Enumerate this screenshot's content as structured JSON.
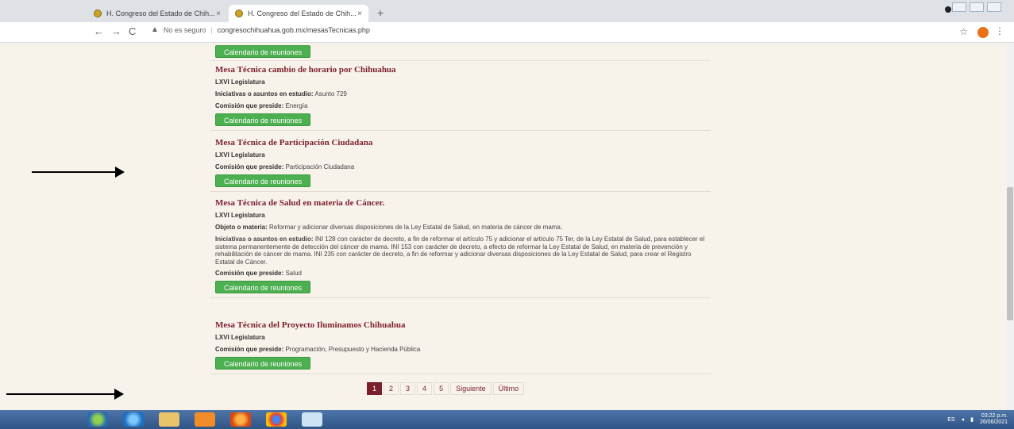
{
  "browser": {
    "tabs": [
      {
        "label": "H. Congreso del Estado de Chih...",
        "close": "×"
      },
      {
        "label": "H. Congreso del Estado de Chih...",
        "close": "×"
      }
    ],
    "new_tab": "+",
    "nav": {
      "back": "←",
      "forward": "→",
      "reload": "C"
    },
    "security_label": "No es seguro",
    "url": "congresochihuahua.gob.mx/mesasTecnicas.php",
    "star": "☆",
    "menu": "⋮"
  },
  "top_button": "Calendario de reuniones",
  "entries": [
    {
      "title": "Mesa Técnica cambio de horario por Chihuahua",
      "legislatura": "LXVI Legislatura",
      "iniciativas_label": "Iniciativas o asuntos en estudio:",
      "iniciativas_value": " Asunto 729",
      "comision_label": "Comisión que preside:",
      "comision_value": " Energía",
      "button": "Calendario de reuniones"
    },
    {
      "title": "Mesa Técnica de Participación Ciudadana",
      "legislatura": "LXVI Legislatura",
      "comision_label": "Comisión que preside:",
      "comision_value": " Participación Ciudadana",
      "button": "Calendario de reuniones"
    },
    {
      "title": "Mesa Técnica de Salud en materia de Cáncer.",
      "legislatura": "LXVI Legislatura",
      "objeto_label": "Objeto o materia:",
      "objeto_value": " Reformar y adicionar diversas disposiciones de la Ley Estatal de Salud, en materia de cáncer de mama.",
      "iniciativas_label": "Iniciativas o asuntos en estudio:",
      "iniciativas_value": " INI 128 con carácter de decreto, a fin de reformar el artículo 75 y adicionar el artículo 75 Ter, de la Ley Estatal de Salud, para establecer el sistema permanentemente de detección del cáncer de mama. INI 153 con carácter de decreto, a efecto de reformar la Ley Estatal de Salud, en materia de prevención y rehabilitación de cáncer de mama. INI 235 con carácter de decreto, a fin de reformar y adicionar diversas disposiciones de la Ley Estatal de Salud, para crear el Registro Estatal de Cáncer.",
      "comision_label": "Comisión que preside:",
      "comision_value": " Salud",
      "button": "Calendario de reuniones"
    },
    {
      "title": "Mesa Técnica del Proyecto Iluminamos Chihuahua",
      "legislatura": "LXVI Legislatura",
      "comision_label": "Comisión que preside:",
      "comision_value": " Programación, Presupuesto y Hacienda Pública",
      "button": "Calendario de reuniones"
    }
  ],
  "pagination": {
    "pages": [
      "1",
      "2",
      "3",
      "4",
      "5"
    ],
    "current": "1",
    "next": "Siguiente",
    "last": "Último"
  },
  "tray": {
    "lang": "ES",
    "time": "03:22 p.m.",
    "date": "26/06/2021"
  },
  "colors": {
    "accent": "#7b1f2a",
    "button": "#4caf50",
    "page_bg": "#f7f2ea"
  }
}
